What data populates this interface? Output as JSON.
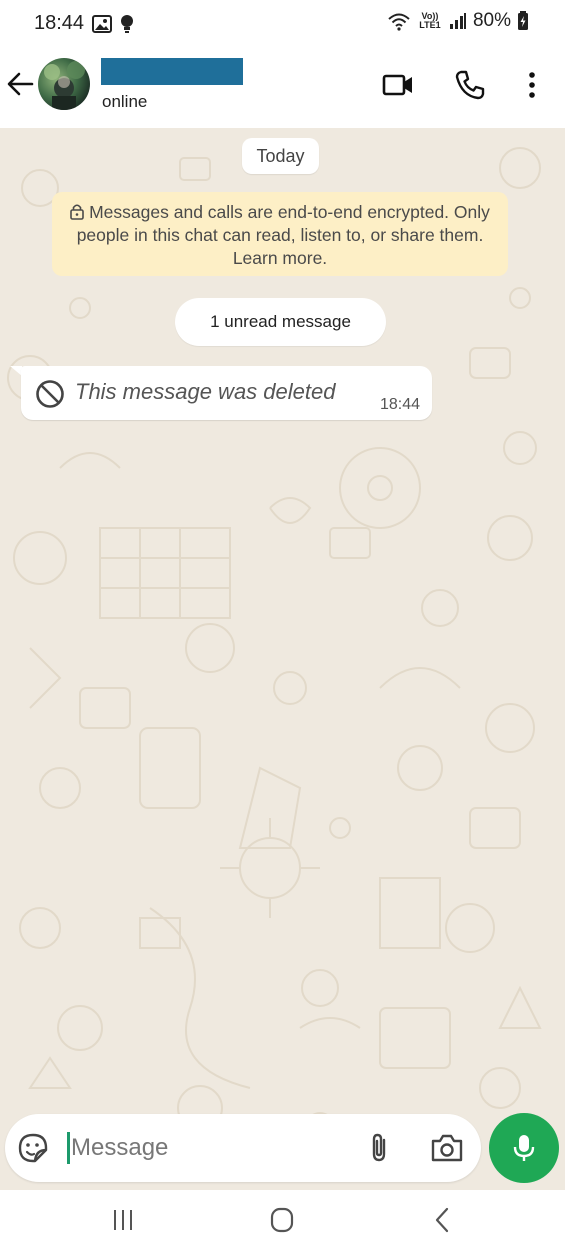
{
  "status_bar": {
    "time": "18:44",
    "network_label": "Vo)) LTE1",
    "battery": "80%"
  },
  "header": {
    "contact_name": "",
    "contact_status": "online",
    "icons": [
      "back-arrow-icon",
      "video-call-icon",
      "voice-call-icon",
      "more-options-icon"
    ]
  },
  "chat": {
    "date_label": "Today",
    "encryption_notice": "Messages and calls are end-to-end encrypted. Only people in this chat can read, listen to, or share them. Learn more.",
    "unread_label": "1 unread message",
    "messages": [
      {
        "text": "This message was deleted",
        "time": "18:44",
        "deleted": true
      }
    ]
  },
  "composer": {
    "placeholder": "Message",
    "icons": [
      "sticker-icon",
      "attach-icon",
      "camera-icon",
      "microphone-icon"
    ],
    "accent_color": "#1fa855"
  },
  "nav_bar": {
    "icons": [
      "recent-apps-icon",
      "home-icon",
      "back-icon"
    ]
  }
}
